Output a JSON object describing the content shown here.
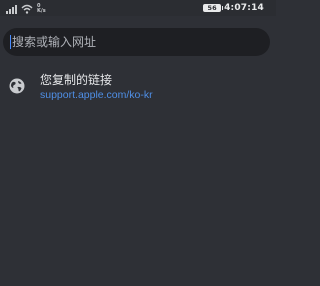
{
  "status_bar": {
    "network_speed_value": "0",
    "network_speed_unit": "K/s",
    "battery": "56",
    "time": "4:07:14"
  },
  "search": {
    "placeholder": "搜索或输入网址"
  },
  "suggestion": {
    "title": "您复制的链接",
    "url": "support.apple.com/ko-kr"
  },
  "colors": {
    "background": "#2e3036",
    "search_bar": "#1e1f23",
    "link": "#4f8fe6",
    "caret": "#4a8dff"
  }
}
